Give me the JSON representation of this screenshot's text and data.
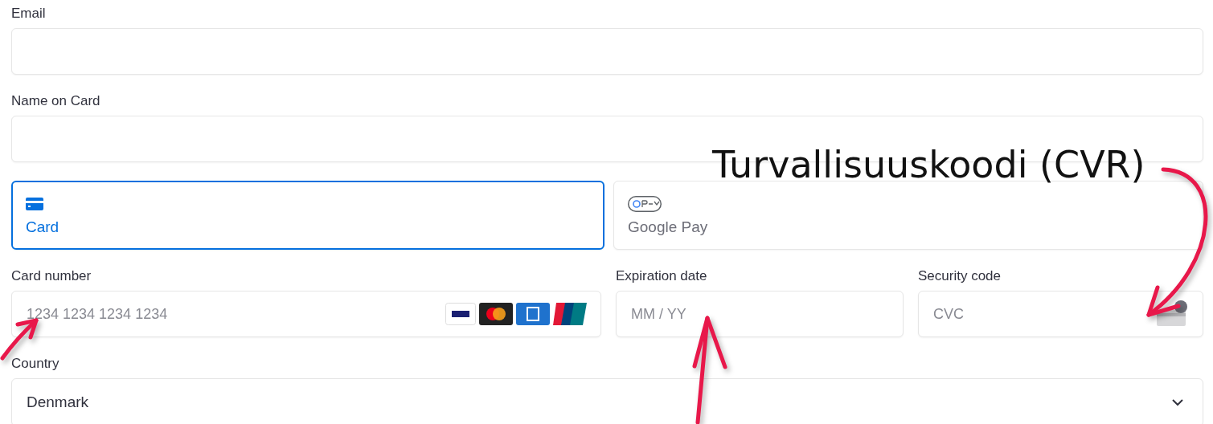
{
  "fields": [
    {
      "label": "Email"
    },
    {
      "label": "Name on Card"
    }
  ],
  "payment_tabs": [
    {
      "label": "Card",
      "kind": "card",
      "selected": true
    },
    {
      "label": "Google Pay",
      "kind": "gpay",
      "selected": false
    }
  ],
  "card_fields": [
    {
      "label": "Card number",
      "placeholder": "1234 1234 1234 1234",
      "kind": "card_number"
    },
    {
      "label": "Expiration date",
      "placeholder": "MM / YY",
      "kind": "plain"
    },
    {
      "label": "Security code",
      "placeholder": "CVC",
      "kind": "cvc"
    }
  ],
  "country": {
    "label": "Country",
    "value": "Denmark"
  },
  "annotation": {
    "text": "Turvallisuuskoodi (CVR)"
  }
}
